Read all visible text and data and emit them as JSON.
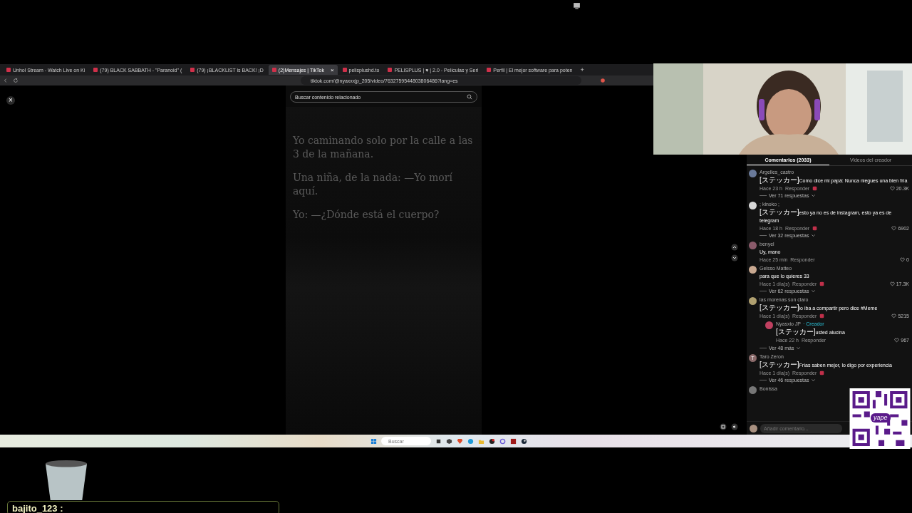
{
  "browser": {
    "tabs": [
      {
        "title": "Unhol Stream - Watch Live on Ki",
        "selected": false
      },
      {
        "title": "(79) BLACK SABBATH - \"Paranoid\" (",
        "selected": false
      },
      {
        "title": "(79) ¡BLACKLIST is BACK! ¡D",
        "selected": false
      },
      {
        "title": "(2)Mensajes | TikTok",
        "selected": true,
        "close": "×"
      },
      {
        "title": "pelisplushd.to",
        "selected": false
      },
      {
        "title": "PELISPLUS | ♥ | 2.0 - Películas y Seri",
        "selected": false
      },
      {
        "title": "Perfil | El mejor software para poten",
        "selected": false
      }
    ],
    "new_tab": "+",
    "url": "tiktok.com/@nyaxxxjp_205/video/7632759544803806486?lang=es"
  },
  "page": {
    "close": "×",
    "search": {
      "placeholder": "Buscar contenido relacionado"
    },
    "video_text": [
      "Yo caminando solo por la calle a las 3 de la mañana.",
      "Una niña, de la nada: —Yo morí aquí.",
      "Yo: —¿Dónde está el cuerpo?"
    ],
    "panel_tabs": [
      {
        "label": "Comentarios (2033)",
        "selected": true
      },
      {
        "label": "Videos del creador",
        "selected": false
      }
    ],
    "comments": [
      {
        "user": "Argelles_castro",
        "tag": "[ステッカー]",
        "text": "Como dice mi papá: Nunca niegues una bien fría",
        "time": "Hace 23 h",
        "reply": "Responder",
        "reacted": true,
        "likes": "20.3K",
        "replies": "Ver 71 respuestas",
        "color": "#6a7a9a"
      },
      {
        "user": "; kinoko ;",
        "tag": "[ステッカー]",
        "text": "esto ya no es de instagram, esto ya es de telegram",
        "time": "Hace 18 h",
        "reply": "Responder",
        "reacted": true,
        "likes": "6902",
        "replies": "Ver 32 respuestas",
        "color": "#d8d8d8"
      },
      {
        "user": "benyel",
        "text": "Uy, mano",
        "time": "Hace 25 min",
        "reply": "Responder",
        "reacted": false,
        "likes": "0",
        "color": "#8a5a6a"
      },
      {
        "user": "Gelsso Matteo",
        "text": "para que lo quieres 33",
        "time": "Hace 1 día(s)",
        "reply": "Responder",
        "reacted": true,
        "likes": "17.3K",
        "replies": "Ver 62 respuestas",
        "color": "#c8a890"
      },
      {
        "user": "las morenas son claro",
        "tag": "[ステッカー]",
        "text": "lo iba a compartir pero dice #Meme",
        "time": "Hace 1 día(s)",
        "reply": "Responder",
        "reacted": true,
        "likes": "5215",
        "color": "#b0a070",
        "children": [
          {
            "user": "Nyasxio JP",
            "badge": "· Creador",
            "tag": "[ステッカー]",
            "text": "usted alucina",
            "time": "Hace 22 h",
            "reply": "Responder",
            "reacted": false,
            "likes": "967",
            "color": "#c04060"
          }
        ],
        "replies": "Ver 48 más"
      },
      {
        "user": "Taro Zeron",
        "avatar_letter": "T",
        "tag": "[ステッカー]",
        "text": "Frías saben mejor, lo digo por experiencia",
        "time": "Hace 1 día(s)",
        "reply": "Responder",
        "reacted": true,
        "replies": "Ver 46 respuestas",
        "color": "#8a6a6a"
      },
      {
        "user": "Bonissa",
        "color": "#777777"
      }
    ],
    "comment_input": {
      "placeholder": "Añadir comentario..."
    }
  },
  "taskbar": {
    "search": {
      "placeholder": "Buscar"
    }
  },
  "qr_label": "yape",
  "chat": {
    "user": "bajito_123 :"
  }
}
